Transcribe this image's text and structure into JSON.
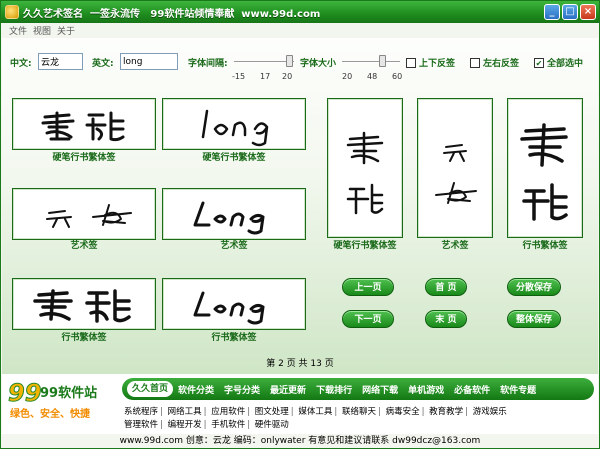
{
  "window": {
    "title": "久久艺术签名  一签永流传   99软件站倾情奉献  www.99d.com",
    "min_label": "_",
    "max_label": "□",
    "close_label": "×"
  },
  "menu": [
    "文件",
    "视图",
    "关于"
  ],
  "controls": {
    "cn_label": "中文:",
    "cn_value": "云龙",
    "en_label": "英文:",
    "en_value": "long",
    "spacing_label": "字体间隔:",
    "spacing_ticks": [
      "-15",
      "17",
      "20"
    ],
    "spacing_value": 20,
    "size_label": "字体大小",
    "size_ticks": [
      "20",
      "48",
      "60"
    ],
    "size_value": 48,
    "flip_v_label": "上下反签",
    "flip_v_checked": false,
    "flip_h_label": "左右反签",
    "flip_h_checked": false,
    "select_all_label": "全部选中",
    "select_all_checked": true
  },
  "signatures": [
    {
      "caption": "硬笔行书繁体签",
      "text": "雲 龍"
    },
    {
      "caption": "硬笔行书繁体签",
      "text": "long"
    },
    {
      "caption": "艺术签",
      "text": "云 龙"
    },
    {
      "caption": "艺术签",
      "text": "Long"
    },
    {
      "caption": "行书繁体签",
      "text": "雲 龍"
    },
    {
      "caption": "行书繁体签",
      "text": "Long"
    },
    {
      "caption": "硬笔行书繁体签",
      "text": "雲 龍"
    },
    {
      "caption": "艺术签",
      "text": "云 龙"
    },
    {
      "caption": "行书繁体签",
      "text": "雲 龍"
    }
  ],
  "buttons": {
    "prev": "上一页",
    "first": "首 页",
    "save_split": "分散保存",
    "next": "下一页",
    "last": "末 页",
    "save_whole": "整体保存"
  },
  "pager": "第 2 页 共 13 页",
  "footer": {
    "logo_text": "99软件站",
    "slogan": "绿色、安全、快捷",
    "nav": [
      "久久首页",
      "软件分类",
      "字号分类",
      "最近更新",
      "下载排行",
      "网络下载",
      "单机游戏",
      "必备软件",
      "软件专题"
    ],
    "links_row1": [
      "系统程序",
      "网络工具",
      "应用软件",
      "图文处理",
      "媒体工具",
      "联络聊天",
      "病毒安全",
      "教育教学",
      "游戏娱乐"
    ],
    "links_row2": [
      "管理软件",
      "编程开发",
      "手机软件",
      "硬件驱动"
    ],
    "status": "www.99d.com  创意：云龙   编码：onlywater 有意见和建议请联系 dw99dcz@163.com"
  },
  "colors": {
    "brand_green": "#1e8c1e",
    "caption_green": "#1a6a1a"
  }
}
